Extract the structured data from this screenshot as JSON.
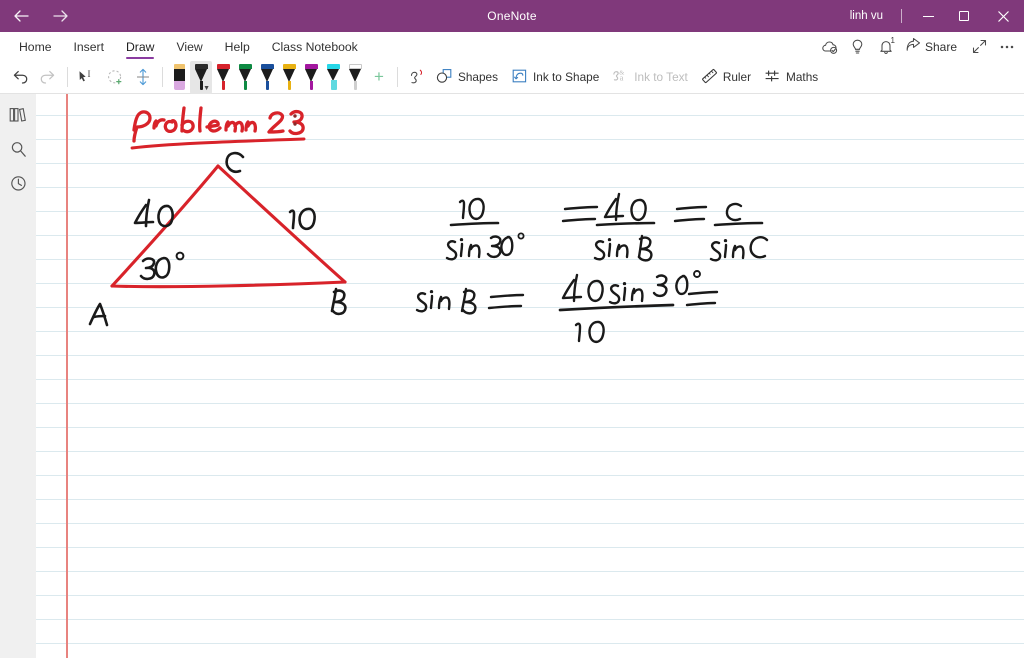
{
  "titlebar": {
    "back_icon": "back-arrow-icon",
    "forward_icon": "forward-arrow-icon",
    "title": "OneNote",
    "user": "linh vu",
    "minimize_label": "–",
    "restore_label": "❐",
    "close_label": "✕"
  },
  "ribbon": {
    "tabs": [
      {
        "label": "Home",
        "active": false
      },
      {
        "label": "Insert",
        "active": false
      },
      {
        "label": "Draw",
        "active": true
      },
      {
        "label": "View",
        "active": false
      },
      {
        "label": "Help",
        "active": false
      },
      {
        "label": "Class Notebook",
        "active": false
      }
    ],
    "right": {
      "sync_icon": "cloud-sync-icon",
      "tell_me_icon": "lightbulb-icon",
      "notifications_icon": "bell-icon",
      "notifications_badge": "1",
      "share_label": "Share",
      "share_icon": "share-icon",
      "fullscreen_icon": "expand-diagonal-icon",
      "more_icon": "ellipsis-icon"
    }
  },
  "toolbar": {
    "undo_icon": "undo-arrow-icon",
    "redo_icon": "redo-arrow-icon",
    "select_type_icon": "lasso-select-text-icon",
    "lasso_icon": "lasso-plus-icon",
    "space_icon": "insert-space-icon",
    "pens": [
      {
        "name": "eraser",
        "type": "eraser",
        "band": "#f0c36d",
        "tip": "#d9a8e0",
        "selected": false
      },
      {
        "name": "pen-black",
        "type": "pen",
        "band": "#2b2b2b",
        "tip": "#1c1c1c",
        "selected": true
      },
      {
        "name": "pen-red",
        "type": "pen",
        "band": "#d6232c",
        "tip": "#d6232c",
        "selected": false
      },
      {
        "name": "pen-green",
        "type": "pen",
        "band": "#0e8a43",
        "tip": "#0e8a43",
        "selected": false
      },
      {
        "name": "pen-blue",
        "type": "pen",
        "band": "#1a4f9c",
        "tip": "#1a4f9c",
        "selected": false
      },
      {
        "name": "pen-yellow",
        "type": "pen",
        "band": "#e8b112",
        "tip": "#e8b112",
        "selected": false
      },
      {
        "name": "pen-purple",
        "type": "pen",
        "band": "#a3179f",
        "tip": "#a3179f",
        "selected": false
      },
      {
        "name": "highlighter-cyan",
        "type": "highlighter",
        "band": "#27d7e8",
        "tip": "#5fd9e0",
        "selected": false
      },
      {
        "name": "pen-white",
        "type": "pen",
        "band": "#ffffff",
        "tip": "#cfcfcf",
        "selected": false
      }
    ],
    "add_pen_label": "+",
    "ink_color_icon": "ink-color-icon",
    "tools": [
      {
        "label": "Shapes",
        "icon": "shapes-icon",
        "disabled": false
      },
      {
        "label": "Ink to Shape",
        "icon": "ink-to-shape-icon",
        "disabled": false
      },
      {
        "label": "Ink to Text",
        "icon": "ink-to-text-icon",
        "disabled": true
      },
      {
        "label": "Ruler",
        "icon": "ruler-icon",
        "disabled": false
      },
      {
        "label": "Maths",
        "icon": "maths-icon",
        "disabled": false
      }
    ]
  },
  "rail": {
    "notebooks_icon": "notebooks-icon",
    "search_icon": "search-icon",
    "recent_icon": "recent-clock-icon"
  },
  "page": {
    "rule_color": "#dbe9ee",
    "margin_color": "#e8837f",
    "ink_red": "#d8232a",
    "ink_black": "#1a1a1a",
    "notes": {
      "heading": "Problem 23 :",
      "triangle": {
        "vertex_labels": [
          "C",
          "A",
          "B"
        ],
        "side_labels": [
          "40",
          "10"
        ],
        "angle_label": "30°"
      },
      "equation_1": "10 / sin 30° = 40 / sin B = c / sin C",
      "equation_2": "sin B = 40 sin 30° / 10 ="
    }
  }
}
